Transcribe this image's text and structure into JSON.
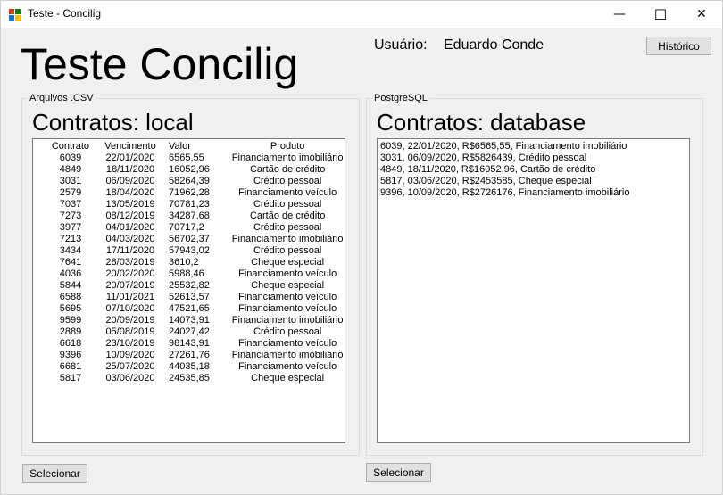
{
  "window": {
    "title": "Teste - Concilig",
    "minimize_glyph": "—",
    "maximize_glyph": "☐",
    "close_glyph": "✕"
  },
  "header": {
    "big_title": "Teste Concilig",
    "user_label": "Usuário:",
    "user_name": "Eduardo Conde",
    "historico_label": "Histórico"
  },
  "csv_group": {
    "caption": "Arquivos .CSV",
    "heading": "Contratos: local",
    "columns": [
      "Contrato",
      "Vencimento",
      "Valor",
      "Produto"
    ],
    "rows": [
      [
        "6039",
        "22/01/2020",
        "6565,55",
        "Financiamento imobiliário"
      ],
      [
        "4849",
        "18/11/2020",
        "16052,96",
        "Cartão de crédito"
      ],
      [
        "3031",
        "06/09/2020",
        "58264,39",
        "Crédito pessoal"
      ],
      [
        "2579",
        "18/04/2020",
        "71962,28",
        "Financiamento veículo"
      ],
      [
        "7037",
        "13/05/2019",
        "70781,23",
        "Crédito pessoal"
      ],
      [
        "7273",
        "08/12/2019",
        "34287,68",
        "Cartão de crédito"
      ],
      [
        "3977",
        "04/01/2020",
        "70717,2",
        "Crédito pessoal"
      ],
      [
        "7213",
        "04/03/2020",
        "56702,37",
        "Financiamento imobiliário"
      ],
      [
        "3434",
        "17/11/2020",
        "57943,02",
        "Crédito pessoal"
      ],
      [
        "7641",
        "28/03/2019",
        "3610,2",
        "Cheque especial"
      ],
      [
        "4036",
        "20/02/2020",
        "5988,46",
        "Financiamento veículo"
      ],
      [
        "5844",
        "20/07/2019",
        "25532,82",
        "Cheque especial"
      ],
      [
        "6588",
        "11/01/2021",
        "52613,57",
        "Financiamento veículo"
      ],
      [
        "5695",
        "07/10/2020",
        "47521,65",
        "Financiamento veículo"
      ],
      [
        "9599",
        "20/09/2019",
        "14073,91",
        "Financiamento imobiliário"
      ],
      [
        "2889",
        "05/08/2019",
        "24027,42",
        "Crédito pessoal"
      ],
      [
        "6618",
        "23/10/2019",
        "98143,91",
        "Financiamento veículo"
      ],
      [
        "9396",
        "10/09/2020",
        "27261,76",
        "Financiamento imobiliário"
      ],
      [
        "6681",
        "25/07/2020",
        "44035,18",
        "Financiamento veículo"
      ],
      [
        "5817",
        "03/06/2020",
        "24535,85",
        "Cheque especial"
      ]
    ],
    "select_label": "Selecionar"
  },
  "db_group": {
    "caption": "PostgreSQL",
    "heading": "Contratos: database",
    "items": [
      "6039, 22/01/2020, R$6565,55, Financiamento imobiliário",
      "3031, 06/09/2020, R$5826439, Crédito pessoal",
      "4849, 18/11/2020, R$16052,96, Cartão de crédito",
      "5817, 03/06/2020, R$2453585, Cheque especial",
      "9396, 10/09/2020, R$2726176, Financiamento imobiliário"
    ],
    "select_label": "Selecionar"
  }
}
